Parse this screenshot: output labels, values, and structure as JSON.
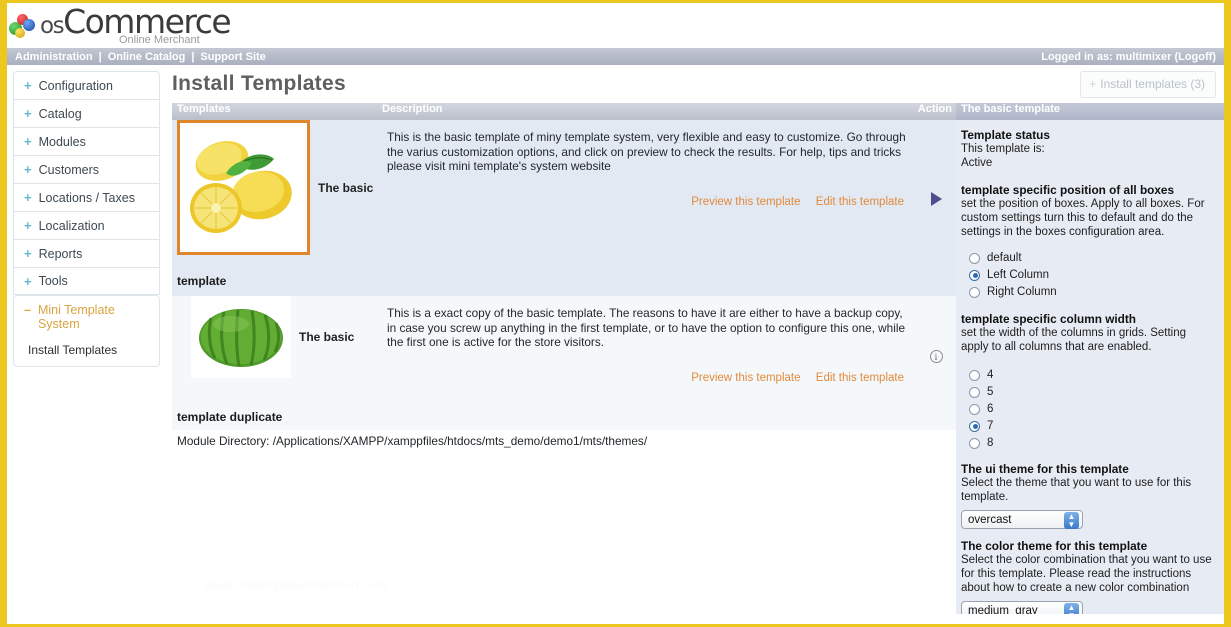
{
  "brand": {
    "name_os": "os",
    "name_commerce": "Commerce",
    "tagline": "Online Merchant",
    "accent_yellow": "#ecc81f"
  },
  "navbar": {
    "items": [
      {
        "label": "Administration"
      },
      {
        "label": "Online Catalog"
      },
      {
        "label": "Support Site"
      }
    ],
    "separator": "|",
    "session": "Logged in as: multimixer (Logoff)"
  },
  "sidebar": {
    "items": [
      {
        "icon": "plus-icon",
        "marker": "+",
        "label": "Configuration"
      },
      {
        "icon": "plus-icon",
        "marker": "+",
        "label": "Catalog"
      },
      {
        "icon": "plus-icon",
        "marker": "+",
        "label": "Modules"
      },
      {
        "icon": "plus-icon",
        "marker": "+",
        "label": "Customers"
      },
      {
        "icon": "plus-icon",
        "marker": "+",
        "label": "Locations / Taxes"
      },
      {
        "icon": "plus-icon",
        "marker": "+",
        "label": "Localization"
      },
      {
        "icon": "plus-icon",
        "marker": "+",
        "label": "Reports"
      },
      {
        "icon": "plus-icon",
        "marker": "+",
        "label": "Tools"
      }
    ],
    "active_group": {
      "icon": "minus-icon",
      "marker": "–",
      "label": "Mini Template System",
      "children": [
        {
          "label": "Install Templates"
        }
      ]
    }
  },
  "main": {
    "page_title": "Install Templates",
    "install_button": {
      "icon": "plus-icon",
      "marker": "+",
      "label": "Install templates (3)"
    },
    "table_headers": {
      "templates": "Templates",
      "description": "Description",
      "action": "Action",
      "panel": "The basic template"
    },
    "rows": [
      {
        "thumb": "lemons-image",
        "template_name": "The basic",
        "description": "This is the basic template of miny template system, very flexible and easy to customize. Go through the varius customization options, and click on preview to check the results. For help, tips and tricks please visit mini template's system website",
        "links": [
          "Preview this template",
          "Edit this template"
        ],
        "action_icon": "play-triangle-icon",
        "folder_label": "template"
      },
      {
        "thumb": "watermelon-image",
        "template_name": "The basic",
        "description": "This is a exact copy of the basic template. The reasons to have it are either to have a backup copy, in case you screw up anything in the first template, or to have the option to configure this one, while the first one is active for the store visitors.",
        "links": [
          "Preview this template",
          "Edit this template"
        ],
        "action_icon": "info-circle-icon",
        "folder_label": "template duplicate"
      }
    ],
    "module_directory": "Module Directory: /Applications/XAMPP/xamppfiles/htdocs/mts_demo/demo1/mts/themes/",
    "watermark": "www.thetemplatecollection.com"
  },
  "panel": {
    "status": {
      "heading": "Template status",
      "line1": "This template is:",
      "line2": "Active"
    },
    "position": {
      "heading": "template specific position of all boxes",
      "description": "set the position of boxes. Apply to all boxes. For custom settings turn this to default and do the settings in the boxes configuration area.",
      "options": [
        {
          "label": "default",
          "selected": false
        },
        {
          "label": "Left Column",
          "selected": true
        },
        {
          "label": "Right Column",
          "selected": false
        }
      ]
    },
    "column_width": {
      "heading": "template specific column width",
      "description": "set the width of the columns in grids. Setting apply to all columns that are enabled.",
      "options": [
        {
          "label": "4",
          "selected": false
        },
        {
          "label": "5",
          "selected": false
        },
        {
          "label": "6",
          "selected": false
        },
        {
          "label": "7",
          "selected": true
        },
        {
          "label": "8",
          "selected": false
        }
      ]
    },
    "ui_theme": {
      "heading": "The ui theme for this template",
      "description": "Select the theme that you want to use for this template.",
      "value": "overcast"
    },
    "color_theme": {
      "heading": "The color theme for this template",
      "description": "Select the color combination that you want to use for this template. Please read the instructions about how to create a new color combination",
      "value": "medium_gray"
    }
  }
}
